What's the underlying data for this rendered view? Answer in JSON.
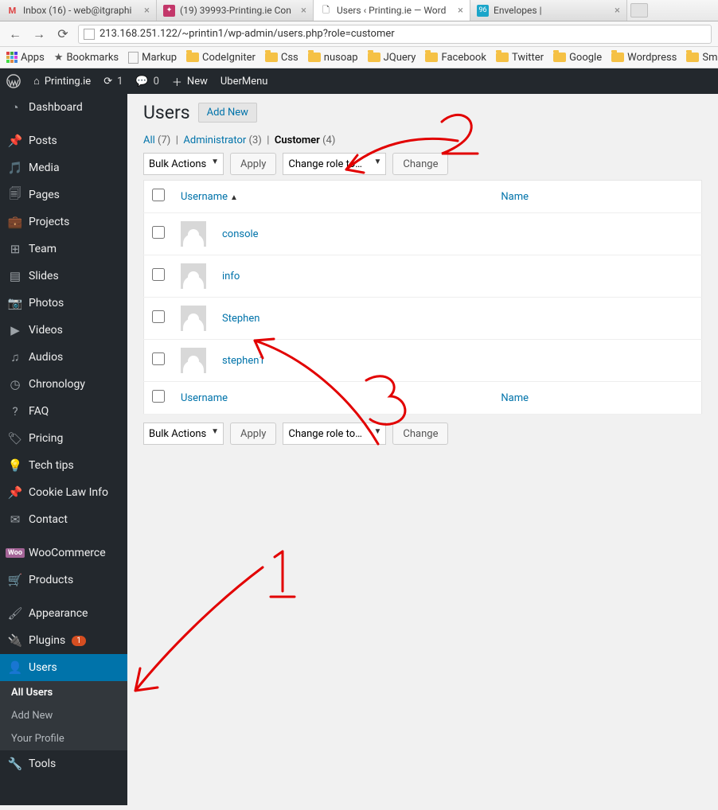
{
  "browser": {
    "tabs": [
      {
        "label": "Inbox (16) - web@itgraphi"
      },
      {
        "label": "(19) 39993-Printing.ie Con"
      },
      {
        "label": "Users ‹ Printing.ie — Word"
      },
      {
        "label": "Envelopes |"
      }
    ],
    "url": "213.168.251.122/~printin1/wp-admin/users.php?role=customer",
    "bookmarks": [
      "Apps",
      "Bookmarks",
      "Markup",
      "CodeIgniter",
      "Css",
      "nusoap",
      "JQuery",
      "Facebook",
      "Twitter",
      "Google",
      "Wordpress",
      "SmartGi"
    ]
  },
  "adminbar": {
    "site": "Printing.ie",
    "updates": "1",
    "comments": "0",
    "new": "New",
    "ubermenu": "UberMenu"
  },
  "sidebar": {
    "items": [
      {
        "icon": "dashboard",
        "label": "Dashboard"
      },
      {
        "blank": true
      },
      {
        "icon": "pin",
        "label": "Posts"
      },
      {
        "icon": "media",
        "label": "Media"
      },
      {
        "icon": "page",
        "label": "Pages"
      },
      {
        "icon": "portfolio",
        "label": "Projects"
      },
      {
        "icon": "team",
        "label": "Team"
      },
      {
        "icon": "slides",
        "label": "Slides"
      },
      {
        "icon": "camera",
        "label": "Photos"
      },
      {
        "icon": "video",
        "label": "Videos"
      },
      {
        "icon": "audio",
        "label": "Audios"
      },
      {
        "icon": "clock",
        "label": "Chronology"
      },
      {
        "icon": "help",
        "label": "FAQ"
      },
      {
        "icon": "tag",
        "label": "Pricing"
      },
      {
        "icon": "bulb",
        "label": "Tech tips"
      },
      {
        "icon": "pin",
        "label": "Cookie Law Info"
      },
      {
        "icon": "mail",
        "label": "Contact"
      },
      {
        "blank": true
      },
      {
        "icon": "woo",
        "label": "WooCommerce"
      },
      {
        "icon": "cart",
        "label": "Products"
      },
      {
        "blank": true
      },
      {
        "icon": "brush",
        "label": "Appearance"
      },
      {
        "icon": "plug",
        "label": "Plugins",
        "badge": "1"
      },
      {
        "icon": "user",
        "label": "Users",
        "current": true
      },
      {
        "icon": "wrench",
        "label": "Tools"
      }
    ],
    "submenu": [
      "All Users",
      "Add New",
      "Your Profile"
    ]
  },
  "page": {
    "title": "Users",
    "addnew": "Add New",
    "filters": {
      "all": "All",
      "all_count": "(7)",
      "admin": "Administrator",
      "admin_count": "(3)",
      "customer": "Customer",
      "customer_count": "(4)"
    },
    "bulk": "Bulk Actions",
    "apply": "Apply",
    "changerole": "Change role to…",
    "change": "Change",
    "cols": {
      "username": "Username",
      "name": "Name"
    },
    "rows": [
      {
        "username": "console"
      },
      {
        "username": "info"
      },
      {
        "username": "Stephen"
      },
      {
        "username": "stephen1"
      }
    ]
  },
  "annotations": {
    "n1": "1",
    "n2": "2",
    "n3": "3"
  }
}
